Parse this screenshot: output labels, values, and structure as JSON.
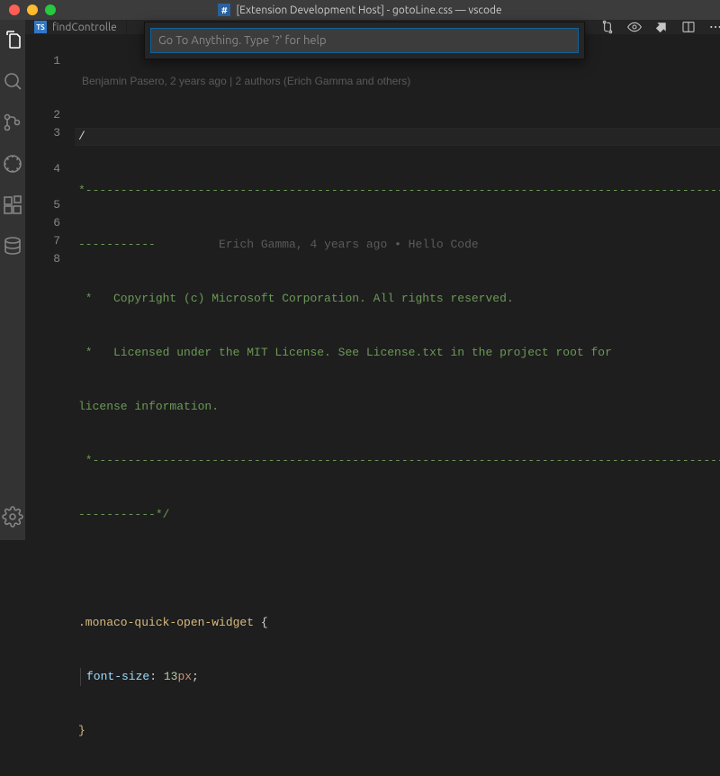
{
  "colors": {
    "trafficRed": "#ff5f57",
    "trafficYellow": "#febc2e",
    "trafficGreen": "#28c840"
  },
  "title": "[Extension Development Host] - gotoLine.css — vscode",
  "tabs": [
    {
      "label": "findControlle"
    }
  ],
  "goto": {
    "placeholder": "Go To Anything. Type '?' for help"
  },
  "blame": {
    "top": "Benjamin Pasero, 2 years ago | 2 authors (Erich Gamma and others)",
    "inline": "Erich Gamma, 4 years ago • Hello Code"
  },
  "gutter": [
    "1",
    "2",
    "3",
    "4",
    "5",
    "6",
    "7",
    "8"
  ],
  "code": {
    "l1": "/",
    "l1b_a": "*-------------------------------------------------------------------------------------------",
    "l1b_b": "-----------",
    "l2": " *   Copyright (c) Microsoft Corporation. All rights reserved.",
    "l3a": " *   Licensed under the MIT License. See License.txt in the project root for",
    "l3b": "license information.",
    "l4a": " *-------------------------------------------------------------------------------------------",
    "l4b": "-----------*/",
    "l6_sel": ".monaco-quick-open-widget",
    "l6_brace": " {",
    "l7_prop": "font-size",
    "l7_colon": ": ",
    "l7_num": "13",
    "l7_unit": "px",
    "l7_semi": ";",
    "l8": "}"
  }
}
